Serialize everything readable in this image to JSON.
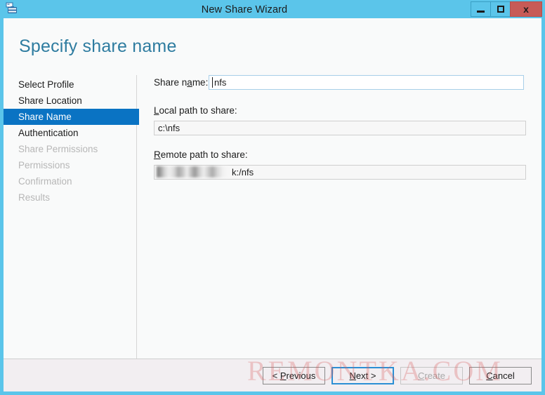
{
  "window": {
    "title": "New Share Wizard",
    "icon": "share-server-icon",
    "controls": {
      "minimize": "–",
      "maximize": "□",
      "close": "x"
    },
    "title_bar_color": "#5bc5ea",
    "close_button_color": "#c75b57"
  },
  "page": {
    "heading": "Specify share name",
    "heading_color": "#2e7ca0"
  },
  "sidebar": {
    "selected_color": "#0a73c3",
    "items": [
      {
        "label": "Select Profile",
        "state": "completed"
      },
      {
        "label": "Share Location",
        "state": "completed"
      },
      {
        "label": "Share Name",
        "state": "selected"
      },
      {
        "label": "Authentication",
        "state": "completed"
      },
      {
        "label": "Share Permissions",
        "state": "disabled"
      },
      {
        "label": "Permissions",
        "state": "disabled"
      },
      {
        "label": "Confirmation",
        "state": "disabled"
      },
      {
        "label": "Results",
        "state": "disabled"
      }
    ]
  },
  "main": {
    "share_name": {
      "label_before": "Share n",
      "label_accel": "a",
      "label_after": "me:",
      "value": "nfs",
      "placeholder": "",
      "focused": true
    },
    "local_path": {
      "label_accel": "L",
      "label_after": "ocal path to share:",
      "value": "c:\\nfs",
      "placeholder": ""
    },
    "remote_path": {
      "label_accel": "R",
      "label_after": "emote path to share:",
      "value_hidden": "",
      "value_visible": "k:/nfs",
      "placeholder": "",
      "redacted": true
    }
  },
  "footer": {
    "buttons": [
      {
        "name": "previous",
        "before": "< ",
        "accel": "P",
        "after": "revious",
        "state": "enabled"
      },
      {
        "name": "next",
        "before": "",
        "accel": "N",
        "after": "ext >",
        "state": "focused"
      },
      {
        "name": "create",
        "before": "",
        "accel": "C",
        "after": "reate",
        "state": "disabled"
      },
      {
        "name": "cancel",
        "before": "",
        "accel": "C",
        "after": "ancel",
        "state": "enabled"
      }
    ]
  },
  "watermark": {
    "text": "REMONTKA.COM"
  },
  "background": {
    "fragment": "t"
  }
}
